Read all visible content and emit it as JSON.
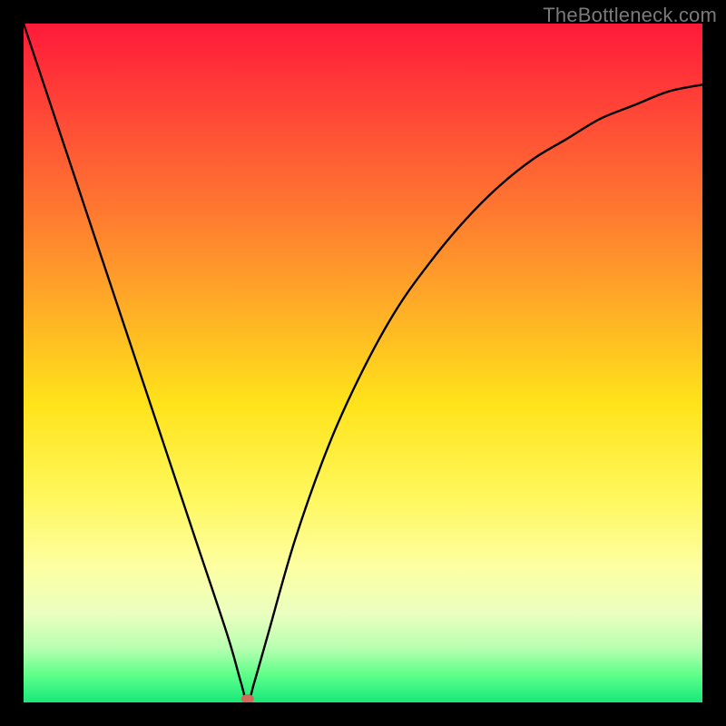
{
  "watermark": "TheBottleneck.com",
  "colors": {
    "background": "#000000",
    "gradient_top": "#ff1a3a",
    "gradient_bottom": "#18e87a",
    "curve": "#000000",
    "marker": "#d46a5a"
  },
  "chart_data": {
    "type": "line",
    "title": "",
    "xlabel": "",
    "ylabel": "",
    "xlim": [
      0,
      100
    ],
    "ylim": [
      0,
      100
    ],
    "annotations": [
      {
        "name": "minimum-marker",
        "x": 33,
        "y": 0
      }
    ],
    "series": [
      {
        "name": "bottleneck-curve",
        "x": [
          0,
          5,
          10,
          15,
          20,
          25,
          30,
          32,
          33,
          34,
          36,
          40,
          45,
          50,
          55,
          60,
          65,
          70,
          75,
          80,
          85,
          90,
          95,
          100
        ],
        "values": [
          100,
          85,
          70,
          55,
          40,
          25,
          10,
          3,
          0,
          3,
          10,
          24,
          38,
          49,
          58,
          65,
          71,
          76,
          80,
          83,
          86,
          88,
          90,
          91
        ]
      }
    ]
  }
}
